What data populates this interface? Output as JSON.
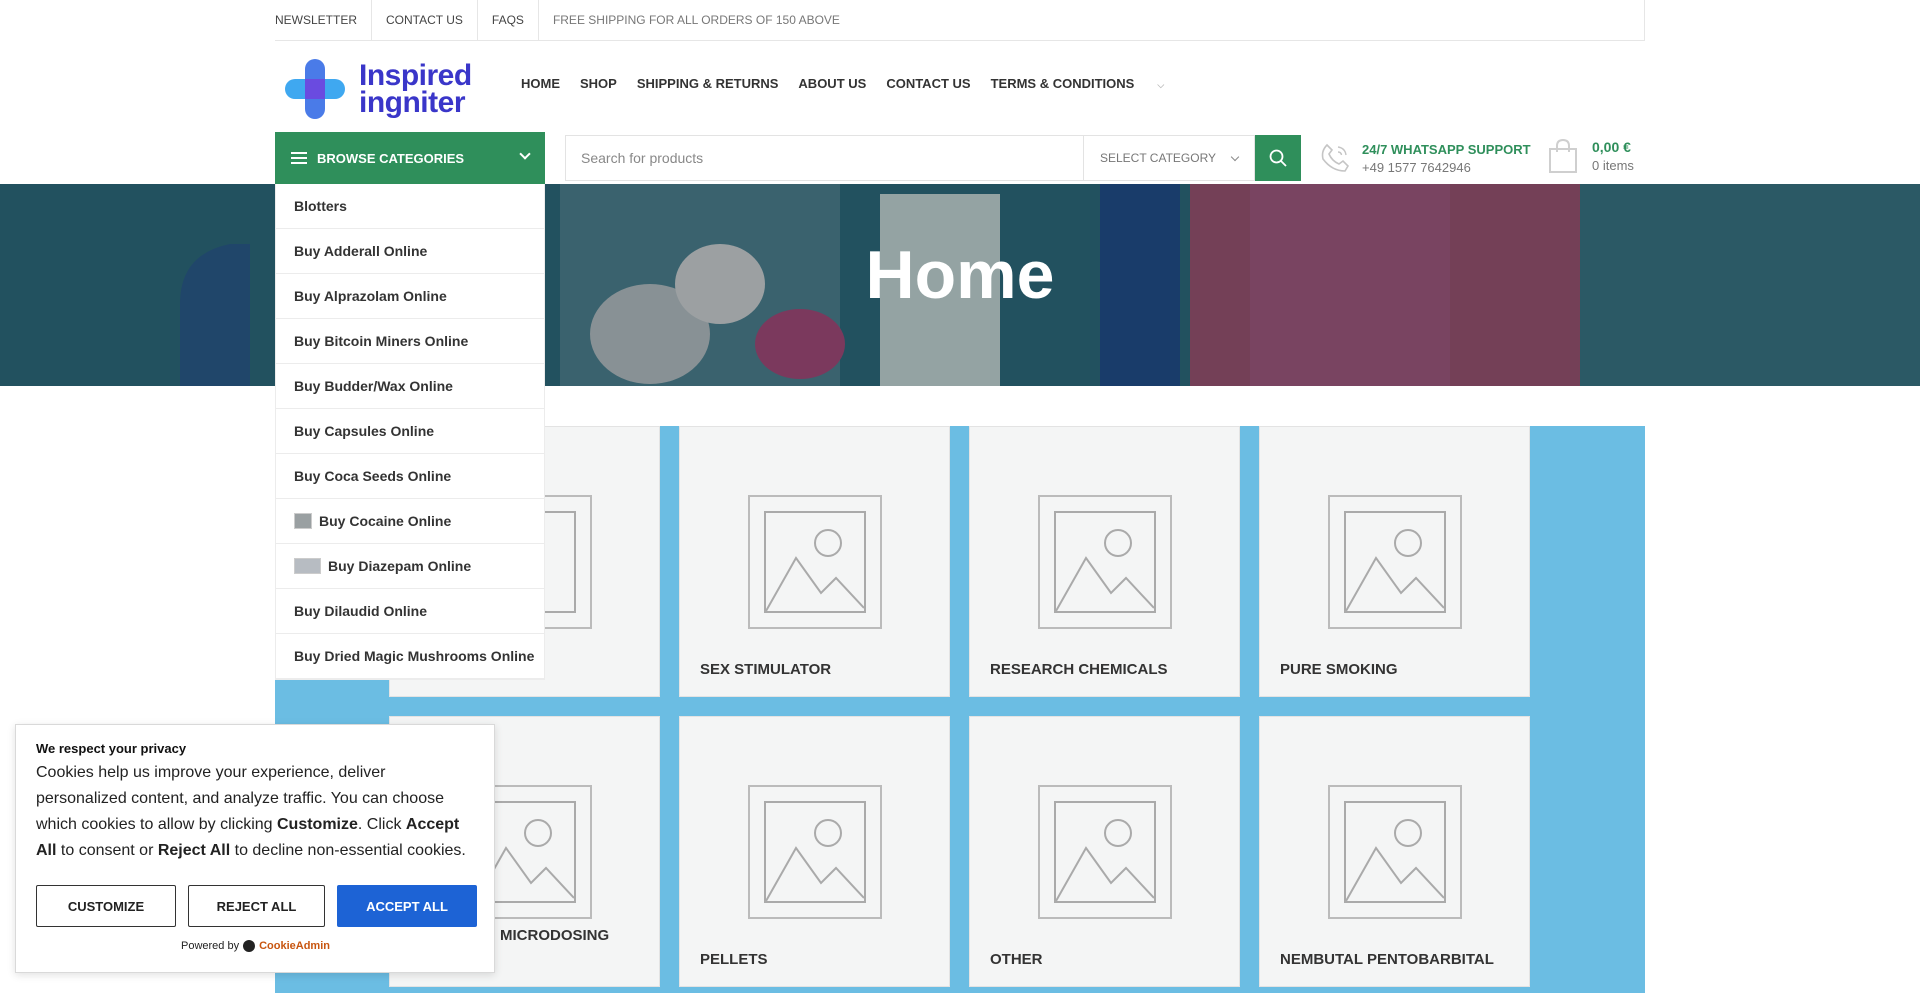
{
  "topbar": {
    "links": [
      "NEWSLETTER",
      "CONTACT US",
      "FAQS"
    ],
    "notice": "FREE SHIPPING FOR ALL ORDERS OF 150 ABOVE"
  },
  "logo": {
    "line1": "Inspired",
    "line2": "ingniter"
  },
  "nav": [
    "HOME",
    "SHOP",
    "SHIPPING & RETURNS",
    "ABOUT US",
    "CONTACT US",
    "TERMS & CONDITIONS"
  ],
  "browse": {
    "label": "BROWSE CATEGORIES"
  },
  "search": {
    "placeholder": "Search for products",
    "category": "SELECT CATEGORY"
  },
  "support": {
    "title": "24/7 WHATSAPP SUPPORT",
    "phone": "+49 1577 7642946"
  },
  "cart": {
    "total": "0,00 €",
    "items": "0 items"
  },
  "hero": {
    "title": "Home"
  },
  "categories": [
    "Blotters",
    "Buy Adderall Online",
    "Buy Alprazolam Online",
    "Buy Bitcoin Miners Online",
    "Buy Budder/Wax Online",
    "Buy Capsules Online",
    "Buy Coca Seeds Online",
    "Buy Cocaine Online",
    "Buy Diazepam Online",
    "Buy Dilaudid Online",
    "Buy Dried Magic Mushrooms Online"
  ],
  "products": {
    "row1": [
      "SEX STIMULATOR",
      "RESEARCH CHEMICALS",
      "PURE SMOKING"
    ],
    "row2": [
      "MICRODOSING",
      "PELLETS",
      "OTHER",
      "NEMBUTAL PENTOBARBITAL"
    ]
  },
  "cookie": {
    "heading": "We respect your privacy",
    "body_1": "Cookies help us improve your experience, deliver personalized content, and analyze traffic. You can choose which cookies to allow by clicking ",
    "customize_word": "Customize",
    "body_2": ". Click ",
    "accept_word": "Accept All",
    "body_3": " to consent or ",
    "reject_word": "Reject All",
    "body_4": " to decline non-essential cookies.",
    "customize": "CUSTOMIZE",
    "reject": "REJECT ALL",
    "accept": "ACCEPT ALL",
    "powered_by": "Powered by",
    "brand": "CookieAdmin"
  },
  "colors": {
    "green": "#2f8f5b",
    "blue": "#6bbde3",
    "logo": "#3a36c9",
    "accept": "#1d63d5"
  }
}
